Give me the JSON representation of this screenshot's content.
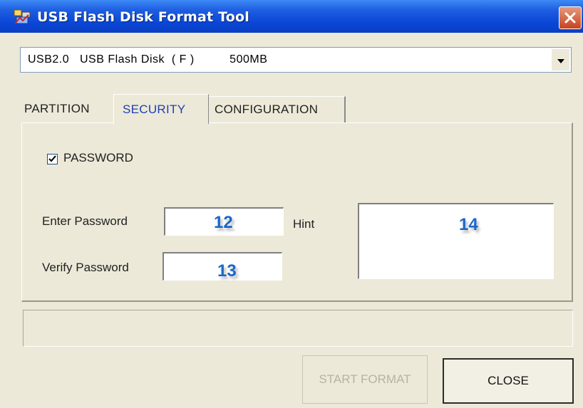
{
  "window": {
    "title": "USB Flash Disk Format Tool"
  },
  "drive_select": {
    "value": "USB2.0   USB Flash Disk  ( F )          500MB"
  },
  "tabs": [
    {
      "label": "PARTITION",
      "active": false
    },
    {
      "label": "SECURITY",
      "active": true
    },
    {
      "label": "CONFIGURATION",
      "active": false
    }
  ],
  "security": {
    "password_checkbox_label": "PASSWORD",
    "password_checked": true,
    "enter_password_label": "Enter Password",
    "verify_password_label": "Verify Password",
    "hint_label": "Hint",
    "callouts": {
      "enter_password": "12",
      "verify_password": "13",
      "hint": "14"
    }
  },
  "buttons": {
    "start_format": "START FORMAT",
    "close": "CLOSE"
  },
  "colors": {
    "titlebar": "#0a46d6",
    "active_tab_text": "#1f3fb3",
    "callout_number": "#1a67c9",
    "window_bg": "#ece9d8"
  },
  "icons": {
    "app": "usb-flash-disk-icon",
    "close": "close-icon",
    "dropdown": "chevron-down-icon",
    "checkbox": "checkmark-icon"
  }
}
